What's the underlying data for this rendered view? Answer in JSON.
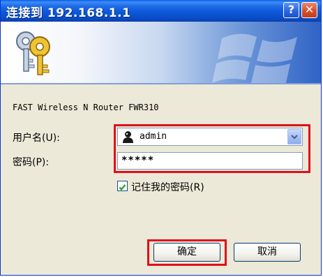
{
  "dialog": {
    "title": "连接到 192.168.1.1",
    "help_button": "?",
    "close_button": "✕",
    "router_name": "FAST Wireless N Router FWR310"
  },
  "form": {
    "username_label": "用户名(U):",
    "username_value": "admin",
    "password_label": "密码(P):",
    "password_value": "*****",
    "remember_label": "记住我的密码(R)",
    "remember_checked": true
  },
  "buttons": {
    "ok_label": "确定",
    "cancel_label": "取消"
  },
  "icons": {
    "banner": "keys-icon",
    "user": "user-icon",
    "dropdown": "chevron-down-icon",
    "check": "check-icon"
  },
  "colors": {
    "highlight": "#e0101a",
    "titlebar": "#0b57d8",
    "dialog_bg": "#ece9d8"
  }
}
